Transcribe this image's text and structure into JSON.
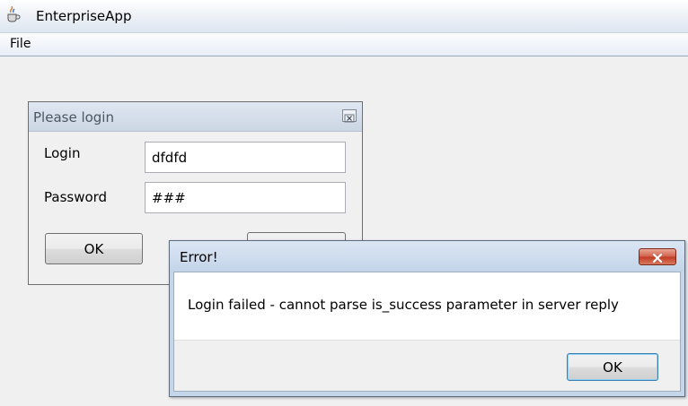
{
  "app": {
    "title": "EnterpriseApp",
    "icon": "java-app-icon"
  },
  "menu": {
    "items": [
      "File"
    ]
  },
  "login": {
    "title": "Please login",
    "login_label": "Login",
    "login_value": "dfdfd",
    "password_label": "Password",
    "password_value": "###",
    "ok_label": "OK",
    "cancel_label": ""
  },
  "error_dialog": {
    "title": "Error!",
    "message": "Login failed - cannot parse is_success parameter in server reply",
    "ok_label": "OK"
  },
  "colors": {
    "close_red": "#c13a22",
    "title_blue": "#c3d4e9"
  }
}
